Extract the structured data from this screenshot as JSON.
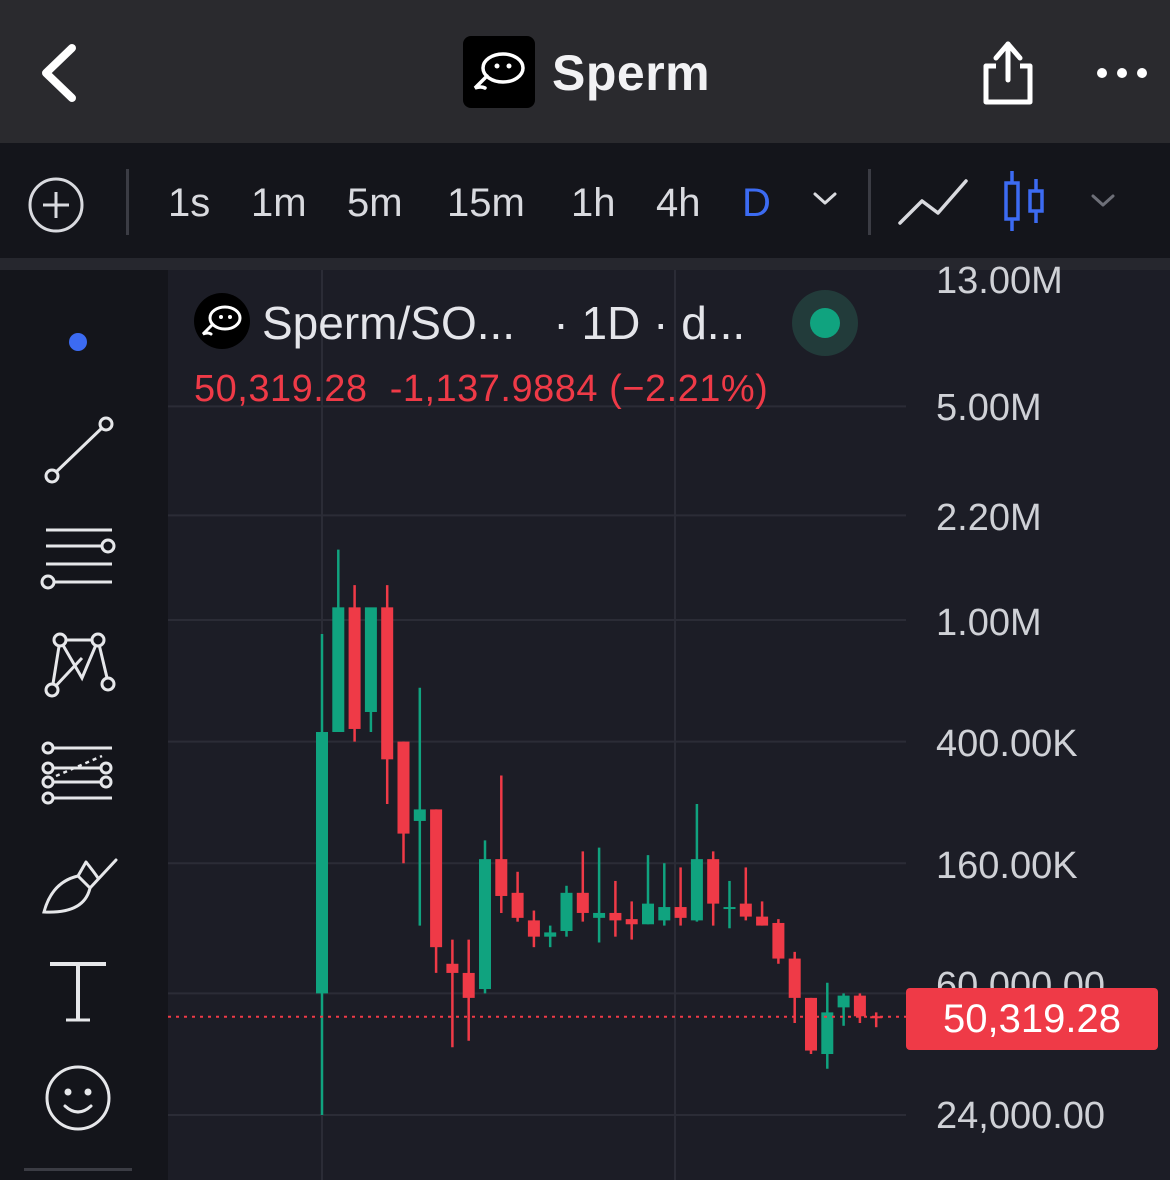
{
  "header": {
    "title": "Sperm",
    "back_icon": "chevron-left-icon",
    "share_icon": "share-icon",
    "more_icon": "more-dots-icon"
  },
  "toolbar": {
    "add_icon": "plus-circle-icon",
    "timeframes": [
      "1s",
      "1m",
      "5m",
      "15m",
      "1h",
      "4h",
      "D"
    ],
    "active_timeframe": "D",
    "timeframe_dropdown_icon": "chevron-down-icon",
    "line_chart_icon": "line-chart-icon",
    "candles_icon": "candlestick-icon",
    "chart_type_dropdown_icon": "chevron-down-icon",
    "accent_color": "#3c6bf2"
  },
  "drawing_tools": [
    "cursor-dot-icon",
    "trend-line-icon",
    "horizontal-lines-icon",
    "pattern-icon",
    "fib-icon",
    "brush-icon",
    "text-tool-icon",
    "emoji-icon"
  ],
  "legend": {
    "symbol": "Sperm/SO...",
    "interval": "· 1D · d...",
    "close": "50,319.28",
    "change": "-1,137.9884",
    "change_pct": "(−2.21%)",
    "status_color": "#10a37f"
  },
  "price_scale": {
    "labels": [
      "13.00M",
      "5.00M",
      "2.20M",
      "1.00M",
      "400.00K",
      "160.00K",
      "60,000.00",
      "24,000.00"
    ],
    "current_price": "50,319.28",
    "current_price_color": "#ef3a47"
  },
  "chart_data": {
    "type": "candlestick",
    "y_scale": "log",
    "up_color": "#10a37f",
    "down_color": "#ef3a47",
    "candles": [
      {
        "o": 60000,
        "h": 900000,
        "l": 24000,
        "c": 430000
      },
      {
        "o": 430000,
        "h": 1700000,
        "l": 430000,
        "c": 1100000
      },
      {
        "o": 1100000,
        "h": 1300000,
        "l": 400000,
        "c": 440000
      },
      {
        "o": 500000,
        "h": 750000,
        "l": 430000,
        "c": 1100000
      },
      {
        "o": 1100000,
        "h": 1300000,
        "l": 250000,
        "c": 350000
      },
      {
        "o": 400000,
        "h": 400000,
        "l": 160000,
        "c": 200000
      },
      {
        "o": 220000,
        "h": 600000,
        "l": 100000,
        "c": 240000
      },
      {
        "o": 240000,
        "h": 240000,
        "l": 70000,
        "c": 85000
      },
      {
        "o": 75000,
        "h": 90000,
        "l": 40000,
        "c": 70000
      },
      {
        "o": 70000,
        "h": 90000,
        "l": 42000,
        "c": 58000
      },
      {
        "o": 62000,
        "h": 190000,
        "l": 60000,
        "c": 165000
      },
      {
        "o": 165000,
        "h": 310000,
        "l": 110000,
        "c": 125000
      },
      {
        "o": 128000,
        "h": 150000,
        "l": 103000,
        "c": 106000
      },
      {
        "o": 104000,
        "h": 112000,
        "l": 85000,
        "c": 92000
      },
      {
        "o": 92000,
        "h": 100000,
        "l": 85000,
        "c": 95000
      },
      {
        "o": 96000,
        "h": 135000,
        "l": 92000,
        "c": 128000
      },
      {
        "o": 128000,
        "h": 175000,
        "l": 103000,
        "c": 110000
      },
      {
        "o": 106000,
        "h": 180000,
        "l": 88000,
        "c": 110000
      },
      {
        "o": 110000,
        "h": 140000,
        "l": 92000,
        "c": 104000
      },
      {
        "o": 105000,
        "h": 120000,
        "l": 90000,
        "c": 101000
      },
      {
        "o": 101000,
        "h": 170000,
        "l": 101000,
        "c": 118000
      },
      {
        "o": 104000,
        "h": 160000,
        "l": 100000,
        "c": 115000
      },
      {
        "o": 115000,
        "h": 155000,
        "l": 100000,
        "c": 106000
      },
      {
        "o": 104000,
        "h": 250000,
        "l": 103000,
        "c": 165000
      },
      {
        "o": 165000,
        "h": 175000,
        "l": 100000,
        "c": 118000
      },
      {
        "o": 115000,
        "h": 140000,
        "l": 98000,
        "c": 115000
      },
      {
        "o": 118000,
        "h": 155000,
        "l": 104000,
        "c": 107000
      },
      {
        "o": 107000,
        "h": 120000,
        "l": 100000,
        "c": 100000
      },
      {
        "o": 102000,
        "h": 105000,
        "l": 75000,
        "c": 78000
      },
      {
        "o": 78000,
        "h": 82000,
        "l": 48000,
        "c": 58000
      },
      {
        "o": 58000,
        "h": 58000,
        "l": 38000,
        "c": 39000
      },
      {
        "o": 38000,
        "h": 65000,
        "l": 34000,
        "c": 52000
      },
      {
        "o": 54000,
        "h": 60000,
        "l": 47000,
        "c": 59000
      },
      {
        "o": 59000,
        "h": 60000,
        "l": 48000,
        "c": 50500
      },
      {
        "o": 50500,
        "h": 52000,
        "l": 46500,
        "c": 50319.28
      }
    ]
  }
}
